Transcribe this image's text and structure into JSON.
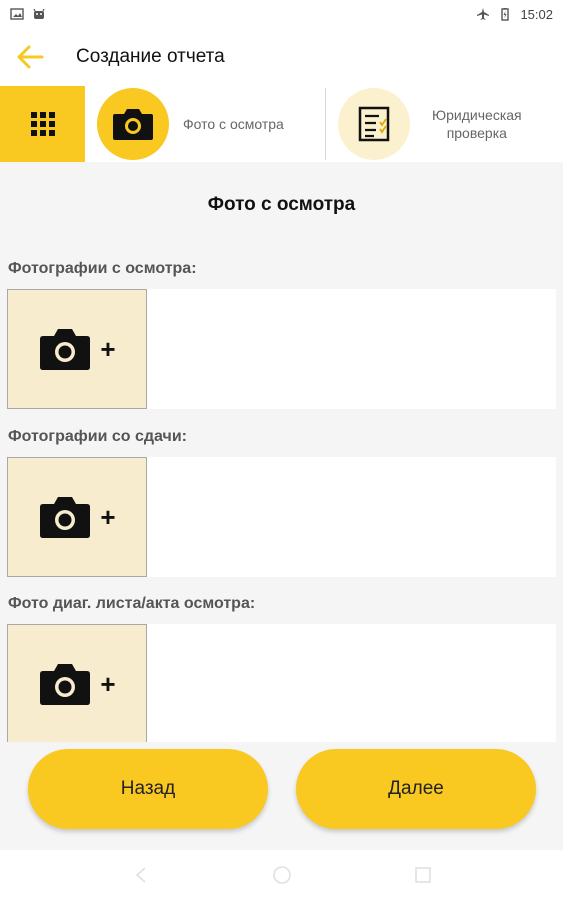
{
  "status_bar": {
    "time": "15:02",
    "left_icons": [
      "image-icon",
      "android-icon"
    ],
    "right_icons": [
      "airplane-icon",
      "battery-icon"
    ]
  },
  "app_bar": {
    "title": "Создание отчета",
    "back_icon": "arrow-left-icon"
  },
  "tabs": {
    "grid_icon": "grid-icon",
    "steps": [
      {
        "label": "Фото с осмотра",
        "icon": "camera-icon",
        "active": true
      },
      {
        "label_line1": "Юридическая",
        "label_line2": "проверка",
        "icon": "checklist-icon",
        "active": false
      }
    ]
  },
  "section": {
    "title": "Фото с осмотра",
    "fields": [
      {
        "label": "Фотографии с осмотра:",
        "add_symbol": "+"
      },
      {
        "label": "Фотографии со сдачи:",
        "add_symbol": "+"
      },
      {
        "label": "Фото диаг. листа/акта осмотра:",
        "add_symbol": "+"
      }
    ]
  },
  "footer": {
    "back_label": "Назад",
    "next_label": "Далее"
  },
  "colors": {
    "accent": "#f9c821",
    "accent_light": "#fbf1cf",
    "photo_bg": "#f7ecce",
    "background": "#f5f5f5"
  }
}
